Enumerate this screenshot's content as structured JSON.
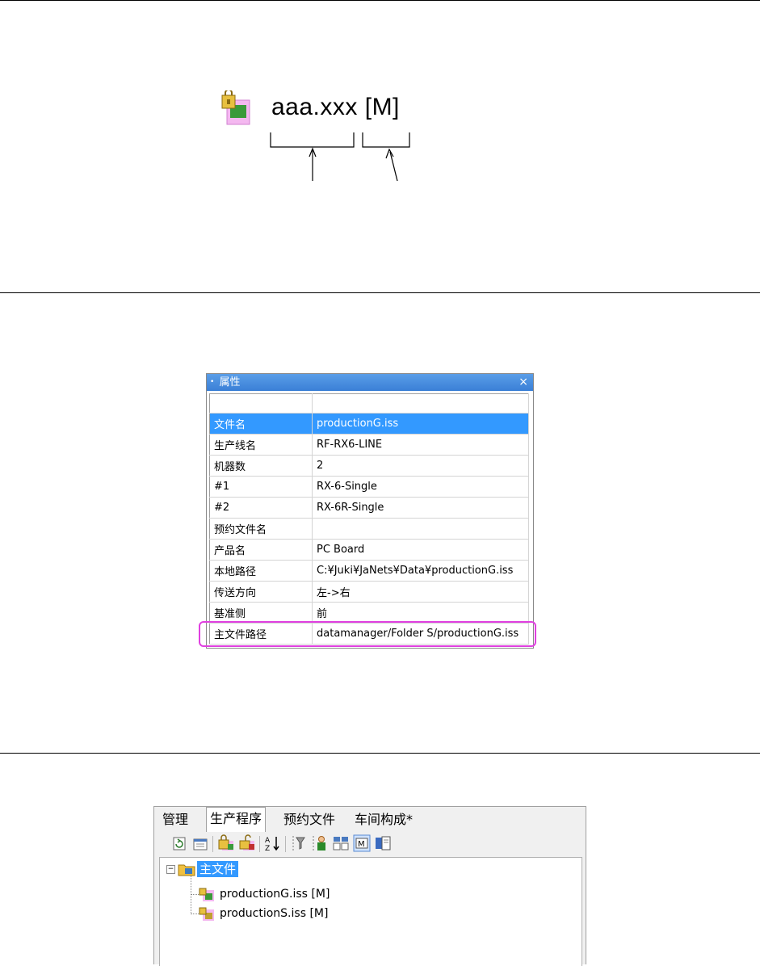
{
  "legend": {
    "file_name": "aaa.xxx",
    "master_marker": "[M]"
  },
  "properties": {
    "title": "属性",
    "close": "×",
    "rows": [
      {
        "key": "文件名",
        "value": "productionG.iss",
        "selected": true
      },
      {
        "key": "生产线名",
        "value": "RF-RX6-LINE"
      },
      {
        "key": "机器数",
        "value": "2"
      },
      {
        "key": "#1",
        "value": "RX-6-Single"
      },
      {
        "key": "#2",
        "value": "RX-6R-Single"
      },
      {
        "key": "预约文件名",
        "value": ""
      },
      {
        "key": "产品名",
        "value": "PC Board"
      },
      {
        "key": "本地路径",
        "value": "C:¥Juki¥JaNets¥Data¥productionG.iss"
      },
      {
        "key": "传送方向",
        "value": "左->右"
      },
      {
        "key": "基准侧",
        "value": "前"
      },
      {
        "key": "主文件路径",
        "value": "datamanager/Folder S/productionG.iss",
        "highlighted": true
      }
    ]
  },
  "tabs": {
    "items": [
      "管理",
      "生产程序",
      "预约文件",
      "车间构成*"
    ],
    "active": "生产程序"
  },
  "toolbar": {
    "icons": [
      "refresh-icon",
      "properties-icon",
      "lock-icon",
      "unlock-icon",
      "sort-icon",
      "filter-icon",
      "user-icon",
      "compare-icon",
      "master-icon",
      "book-icon"
    ]
  },
  "tree": {
    "root": "主文件",
    "children": [
      "productionG.iss [M]",
      "productionS.iss [M]"
    ]
  }
}
